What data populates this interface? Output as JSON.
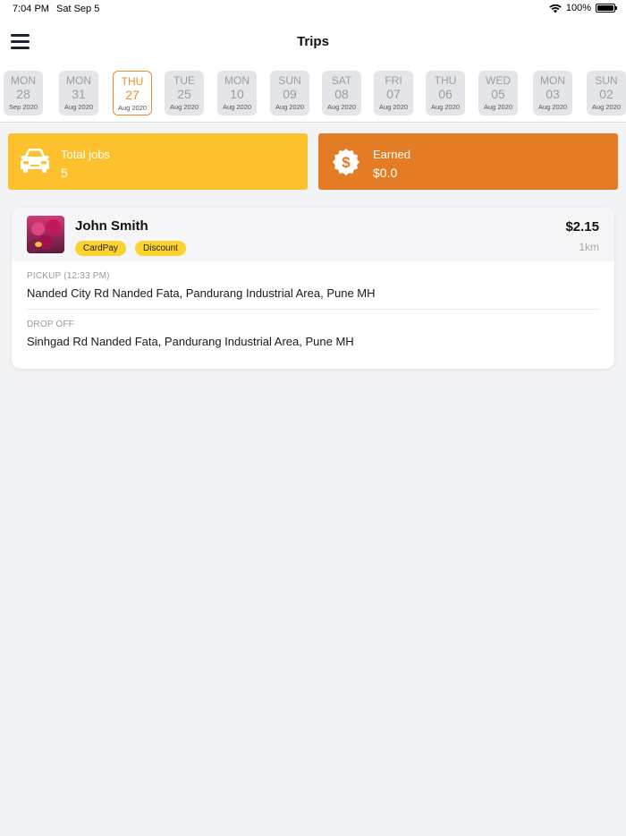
{
  "status_bar": {
    "time": "7:04 PM",
    "date": "Sat Sep 5",
    "battery": "100%"
  },
  "header": {
    "title": "Trips"
  },
  "dates": [
    {
      "day": "MON",
      "num": "28",
      "month": "Sep 2020",
      "active": false
    },
    {
      "day": "MON",
      "num": "31",
      "month": "Aug 2020",
      "active": false
    },
    {
      "day": "THU",
      "num": "27",
      "month": "Aug 2020",
      "active": true
    },
    {
      "day": "TUE",
      "num": "25",
      "month": "Aug 2020",
      "active": false
    },
    {
      "day": "MON",
      "num": "10",
      "month": "Aug 2020",
      "active": false
    },
    {
      "day": "SUN",
      "num": "09",
      "month": "Aug 2020",
      "active": false
    },
    {
      "day": "SAT",
      "num": "08",
      "month": "Aug 2020",
      "active": false
    },
    {
      "day": "FRI",
      "num": "07",
      "month": "Aug 2020",
      "active": false
    },
    {
      "day": "THU",
      "num": "06",
      "month": "Aug 2020",
      "active": false
    },
    {
      "day": "WED",
      "num": "05",
      "month": "Aug 2020",
      "active": false
    },
    {
      "day": "MON",
      "num": "03",
      "month": "Aug 2020",
      "active": false
    },
    {
      "day": "SUN",
      "num": "02",
      "month": "Aug 2020",
      "active": false
    }
  ],
  "stats": {
    "jobs": {
      "label": "Total jobs",
      "value": "5",
      "icon": "car-icon",
      "color": "#fcc12c"
    },
    "earned": {
      "label": "Earned",
      "value": "$0.0",
      "icon": "dollar-badge-icon",
      "color": "#e37c24"
    }
  },
  "trip": {
    "name": "John Smith",
    "tags": [
      "CardPay",
      "Discount"
    ],
    "fare": "$2.15",
    "distance": "1km",
    "pickup_label": "PICKUP (12:33 PM)",
    "pickup_address": "Nanded City Rd Nanded Fata, Pandurang Industrial Area, Pune MH",
    "dropoff_label": "DROP OFF",
    "dropoff_address": "Sinhgad Rd Nanded Fata, Pandurang Industrial Area, Pune MH"
  },
  "colors": {
    "accent": "#f28a2e",
    "tag": "#fcd22e"
  }
}
